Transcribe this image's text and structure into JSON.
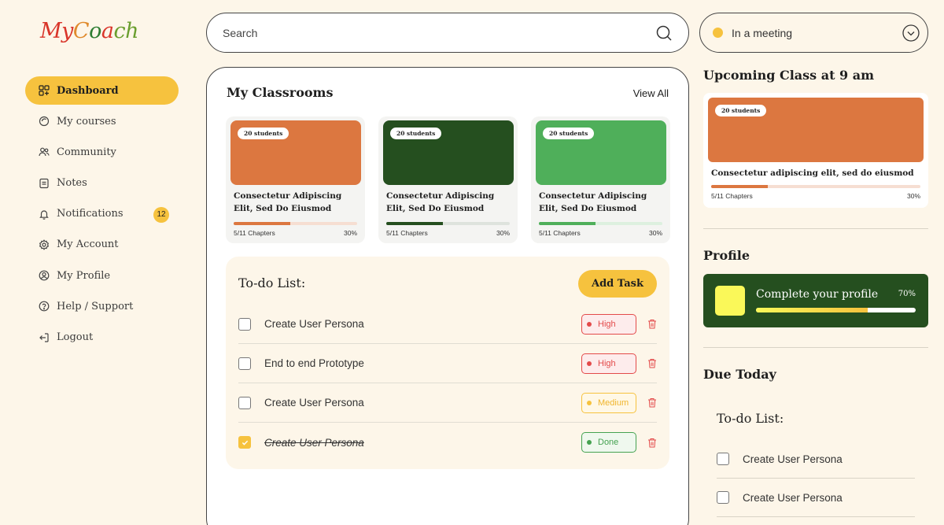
{
  "logo": {
    "part1": "My",
    "part2": "C",
    "part3": "o",
    "part4": "a",
    "part5": "ch"
  },
  "nav": {
    "items": [
      {
        "label": "Dashboard",
        "icon": "dashboard-icon",
        "active": true
      },
      {
        "label": "My courses",
        "icon": "courses-icon"
      },
      {
        "label": "Community",
        "icon": "community-icon"
      },
      {
        "label": "Notes",
        "icon": "notes-icon"
      },
      {
        "label": "Notifications",
        "icon": "bell-icon",
        "badge": "12"
      },
      {
        "label": "My Account",
        "icon": "gear-icon"
      },
      {
        "label": "My Profile",
        "icon": "user-icon"
      },
      {
        "label": "Help / Support",
        "icon": "help-icon"
      },
      {
        "label": "Logout",
        "icon": "logout-icon"
      }
    ]
  },
  "search": {
    "placeholder": "Search"
  },
  "status": {
    "label": "In a meeting",
    "color": "#F6C23E"
  },
  "classrooms": {
    "title": "My Classrooms",
    "view_all": "View All",
    "cards": [
      {
        "students": "20 students",
        "title": "Consectetur Adipiscing Elit, Sed Do Eiusmod",
        "chapters": "5/11 Chapters",
        "percent": "30%",
        "progress": 0.46,
        "color": "#DC7740",
        "bar_fill": "#DC7740",
        "bar_bg": "#F6DED2"
      },
      {
        "students": "20 students",
        "title": "Consectetur Adipiscing Elit, Sed Do Eiusmod",
        "chapters": "5/11 Chapters",
        "percent": "30%",
        "progress": 0.46,
        "color": "#254F1F",
        "bar_fill": "#254F1F",
        "bar_bg": "#DEE3DD"
      },
      {
        "students": "20 students",
        "title": "Consectetur Adipiscing Elit, Sed Do Eiusmod",
        "chapters": "5/11 Chapters",
        "percent": "30%",
        "progress": 0.46,
        "color": "#4FAF5A",
        "bar_fill": "#4FAF5A",
        "bar_bg": "#DDF0DF"
      }
    ]
  },
  "todo": {
    "title": "To-do List:",
    "add_label": "Add Task",
    "tasks": [
      {
        "text": "Create User Persona",
        "priority": "High",
        "checked": false
      },
      {
        "text": "End to end Prototype",
        "priority": "High",
        "checked": false
      },
      {
        "text": "Create User Persona",
        "priority": "Medium",
        "checked": false
      },
      {
        "text": "Create User Persona",
        "priority": "Done",
        "checked": true
      }
    ]
  },
  "upcoming": {
    "title": "Upcoming Class at 9 am",
    "card": {
      "title": "Consectetur adipiscing elit, sed do eiusmod",
      "chapters": "5/11 Chapters",
      "percent": "30%",
      "progress": 0.27,
      "color": "#DC7740"
    }
  },
  "profile": {
    "title": "Profile",
    "label": "Complete your profile",
    "percent": "70%",
    "progress": 0.7
  },
  "due": {
    "title": "Due Today",
    "todo_title": "To-do List:",
    "tasks": [
      {
        "text": "Create User Persona"
      },
      {
        "text": "Create User Persona"
      }
    ]
  }
}
